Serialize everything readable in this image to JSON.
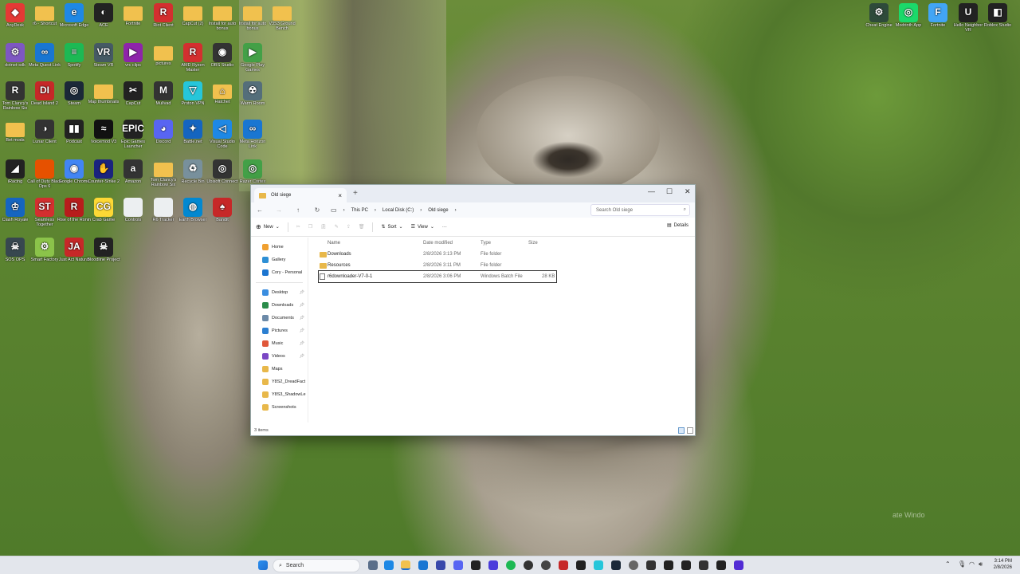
{
  "desktop": {
    "icons": [
      {
        "label": "AnyDesk",
        "color": "#e53935",
        "glyph": "◆"
      },
      {
        "label": "r6 - Shortcut",
        "color": "#f1c14e",
        "glyph": ""
      },
      {
        "label": "Microsoft Edge",
        "color": "#1e88e5",
        "glyph": "e"
      },
      {
        "label": "ACE",
        "color": "#222222",
        "glyph": "◐"
      },
      {
        "label": "Fortnite",
        "color": "#f1c14e",
        "glyph": ""
      },
      {
        "label": "Riot Client",
        "color": "#d32f2f",
        "glyph": "R"
      },
      {
        "label": "CapCut (2)",
        "color": "#f1c14e",
        "glyph": ""
      },
      {
        "label": "Install for auto bonus",
        "color": "#f1c14e",
        "glyph": ""
      },
      {
        "label": "Install for auto bonus",
        "color": "#f1c14e",
        "glyph": ""
      },
      {
        "label": "V3S3 Ground Bench",
        "color": "#f1c14e",
        "glyph": ""
      },
      {
        "label": "dotnet-sdk",
        "color": "#7e57c2",
        "glyph": "⚙"
      },
      {
        "label": "Meta Quest Link",
        "color": "#1976d2",
        "glyph": "∞"
      },
      {
        "label": "Spotify",
        "color": "#1db954",
        "glyph": "≡"
      },
      {
        "label": "Steam VR",
        "color": "#455a64",
        "glyph": "VR"
      },
      {
        "label": "vrc clips",
        "color": "#8e24aa",
        "glyph": "▶"
      },
      {
        "label": "pictures",
        "color": "#f1c14e",
        "glyph": ""
      },
      {
        "label": "AMD Ryzen Master",
        "color": "#d32f2f",
        "glyph": "R"
      },
      {
        "label": "OBS Studio",
        "color": "#333333",
        "glyph": "◉"
      },
      {
        "label": "Google Play Games",
        "color": "#43a047",
        "glyph": "▶"
      },
      {
        "label": "Tom Clancy's Rainbow Six",
        "color": "#333333",
        "glyph": "R"
      },
      {
        "label": "Dead Island 2",
        "color": "#c62828",
        "glyph": "DI"
      },
      {
        "label": "Steam",
        "color": "#1b2838",
        "glyph": "◎"
      },
      {
        "label": "Map thumbnails",
        "color": "#f1c14e",
        "glyph": ""
      },
      {
        "label": "CapCut",
        "color": "#222222",
        "glyph": "✂"
      },
      {
        "label": "Mullvad",
        "color": "#333333",
        "glyph": "M"
      },
      {
        "label": "Proton VPN",
        "color": "#26c6da",
        "glyph": "▽"
      },
      {
        "label": "Hatchet",
        "color": "#f1c14e",
        "glyph": "⌂"
      },
      {
        "label": "Warm Room",
        "color": "#546e7a",
        "glyph": "☢"
      },
      {
        "label": "Bet mods",
        "color": "#f1c14e",
        "glyph": ""
      },
      {
        "label": "Lunar Client",
        "color": "#333333",
        "glyph": "◑"
      },
      {
        "label": "Podcast",
        "color": "#222222",
        "glyph": "▮▮"
      },
      {
        "label": "Voicemod V3",
        "color": "#111111",
        "glyph": "≈"
      },
      {
        "label": "Epic Games Launcher",
        "color": "#222222",
        "glyph": "EPIC"
      },
      {
        "label": "Discord",
        "color": "#5865f2",
        "glyph": "◕"
      },
      {
        "label": "Battle.net",
        "color": "#1565c0",
        "glyph": "✦"
      },
      {
        "label": "Visual Studio Code",
        "color": "#1e88e5",
        "glyph": "◁"
      },
      {
        "label": "Meta Horizon Link",
        "color": "#1976d2",
        "glyph": "∞"
      },
      {
        "label": "iRacing",
        "color": "#222222",
        "glyph": "◢"
      },
      {
        "label": "Call of Duty Black Ops 6",
        "color": "#e65100",
        "glyph": ""
      },
      {
        "label": "Google Chrome",
        "color": "#4285f4",
        "glyph": "◉"
      },
      {
        "label": "Counter-Strike 2",
        "color": "#1a237e",
        "glyph": "✋"
      },
      {
        "label": "Amazon",
        "color": "#333333",
        "glyph": "a"
      },
      {
        "label": "Tom Clancy's Rainbow Six",
        "color": "#f1c14e",
        "glyph": ""
      },
      {
        "label": "Recycle Bin",
        "color": "#78909c",
        "glyph": "♻"
      },
      {
        "label": "Ubisoft Connect",
        "color": "#333333",
        "glyph": "◎"
      },
      {
        "label": "Razer Cortex",
        "color": "#43a047",
        "glyph": "◎"
      },
      {
        "label": "Clash Royale",
        "color": "#1565c0",
        "glyph": "♔"
      },
      {
        "label": "Seamless Together",
        "color": "#d32f2f",
        "glyph": "ST"
      },
      {
        "label": "Rise of the Ronin",
        "color": "#b71c1c",
        "glyph": "R"
      },
      {
        "label": "Crab Game",
        "color": "#fdd835",
        "glyph": "CG"
      },
      {
        "label": "Controls",
        "color": "#eceff1",
        "glyph": ""
      },
      {
        "label": "R6 Tracker",
        "color": "#eceff1",
        "glyph": ""
      },
      {
        "label": "Earth Browser",
        "color": "#0288d1",
        "glyph": "◍"
      },
      {
        "label": "Bandit",
        "color": "#c62828",
        "glyph": "♠"
      },
      {
        "label": "SOS OPS",
        "color": "#37474f",
        "glyph": "☠"
      },
      {
        "label": "Smart Factory",
        "color": "#8bc34a",
        "glyph": "⚙"
      },
      {
        "label": "Just Act Natural",
        "color": "#c62828",
        "glyph": "JA"
      },
      {
        "label": "Bloodline Project",
        "color": "#222222",
        "glyph": "☠"
      },
      {
        "label": "Cheat Engine",
        "color": "#2e4a3a",
        "glyph": "⚙"
      },
      {
        "label": "Modrinth App",
        "color": "#1bd96a",
        "glyph": "◎"
      },
      {
        "label": "Fortnite",
        "color": "#42a5f5",
        "glyph": "F"
      },
      {
        "label": "Hello Neighbor VR",
        "color": "#222222",
        "glyph": "U"
      },
      {
        "label": "Roblox Studio",
        "color": "#222222",
        "glyph": "◧"
      }
    ]
  },
  "explorer": {
    "tab_title": "Old siege",
    "breadcrumbs": [
      "This PC",
      "Local Disk (C:)",
      "Old siege"
    ],
    "search_placeholder": "Search Old siege",
    "toolbar": {
      "new": "New",
      "sort": "Sort",
      "view": "View",
      "more": "···",
      "details": "Details"
    },
    "nav": {
      "top": [
        {
          "label": "Home",
          "icon": "home-icon",
          "color": "#f0a030",
          "pinned": false
        },
        {
          "label": "Gallery",
          "icon": "gallery-icon",
          "color": "#2d8fd5",
          "pinned": false
        },
        {
          "label": "Cory - Personal",
          "icon": "cloud-icon",
          "color": "#1b75d0",
          "pinned": false
        }
      ],
      "quick": [
        {
          "label": "Desktop",
          "icon": "desktop-icon",
          "color": "#3a8ee0",
          "pinned": true
        },
        {
          "label": "Downloads",
          "icon": "downloads-icon",
          "color": "#2a8c4a",
          "pinned": true
        },
        {
          "label": "Documents",
          "icon": "documents-icon",
          "color": "#6c8aa8",
          "pinned": true
        },
        {
          "label": "Pictures",
          "icon": "pictures-icon",
          "color": "#2c7fd1",
          "pinned": true
        },
        {
          "label": "Music",
          "icon": "music-icon",
          "color": "#e0573a",
          "pinned": true
        },
        {
          "label": "Videos",
          "icon": "videos-icon",
          "color": "#7b47c4",
          "pinned": true
        },
        {
          "label": "Maps",
          "icon": "folder-icon",
          "color": "#e8b84a",
          "pinned": false
        },
        {
          "label": "Y8S2_DreadFact",
          "icon": "folder-icon",
          "color": "#e8b84a",
          "pinned": false
        },
        {
          "label": "Y8S3_ShadowLe",
          "icon": "folder-icon",
          "color": "#e8b84a",
          "pinned": false
        },
        {
          "label": "Screenshots",
          "icon": "folder-icon",
          "color": "#e8b84a",
          "pinned": false
        }
      ]
    },
    "columns": {
      "name": "Name",
      "date": "Date modified",
      "type": "Type",
      "size": "Size"
    },
    "files": [
      {
        "name": "Downloads",
        "date": "2/8/2026 3:13 PM",
        "type": "File folder",
        "size": "",
        "kind": "folder",
        "selected": false
      },
      {
        "name": "Resources",
        "date": "2/8/2026 3:11 PM",
        "type": "File folder",
        "size": "",
        "kind": "folder",
        "selected": false
      },
      {
        "name": "r6downloader-V7-0-1",
        "date": "2/8/2026 3:06 PM",
        "type": "Windows Batch File",
        "size": "28 KB",
        "kind": "batch",
        "selected": true
      }
    ],
    "status": "3 items"
  },
  "taskbar": {
    "search_label": "Search",
    "time": "3:14 PM",
    "date": "2/8/2026"
  },
  "watermark": "ate Windo"
}
